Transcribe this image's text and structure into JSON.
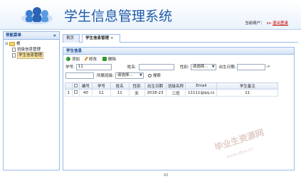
{
  "header": {
    "title": "学生信息管理系统",
    "current_user_label": "当前用户：",
    "current_user": "su",
    "logout": "退出登录"
  },
  "nav": {
    "title": "导航菜单",
    "collapse": "«",
    "root": "根",
    "items": [
      {
        "label": "班级信息管理"
      },
      {
        "label": "学生信息管理"
      }
    ]
  },
  "tabs": [
    {
      "label": "首页"
    },
    {
      "label": "学生信息管理",
      "close": "×"
    }
  ],
  "panel": {
    "title": "学生信息",
    "toolbar": {
      "add": "添加",
      "edit": "修改",
      "delete": "删除"
    },
    "filters": {
      "sno_label": "学号:",
      "sno_value": "11",
      "name_label": "姓名:",
      "name_value": "",
      "sex_label": "性别:",
      "sex_value": "请选择...",
      "birth_label": "出生日期:",
      "birth_from": "",
      "birth_to_sep": "->",
      "birth_to": "",
      "class_label": "所属班级:",
      "class_value": "请选择...",
      "search": "搜索"
    },
    "grid": {
      "columns": [
        "编号",
        "学号",
        "姓名",
        "性别",
        "出生日期",
        "班级名称",
        "Email",
        "学生备注"
      ],
      "rows": [
        {
          "rownum": "1",
          "cells": [
            "40",
            "11",
            "11",
            "女",
            "2018-23",
            "二班",
            "11111@qq.cc",
            "11"
          ]
        }
      ]
    }
  },
  "watermark": {
    "text": "毕业生资源网",
    "url": "www.sbvv.cn"
  },
  "page_number": "42"
}
